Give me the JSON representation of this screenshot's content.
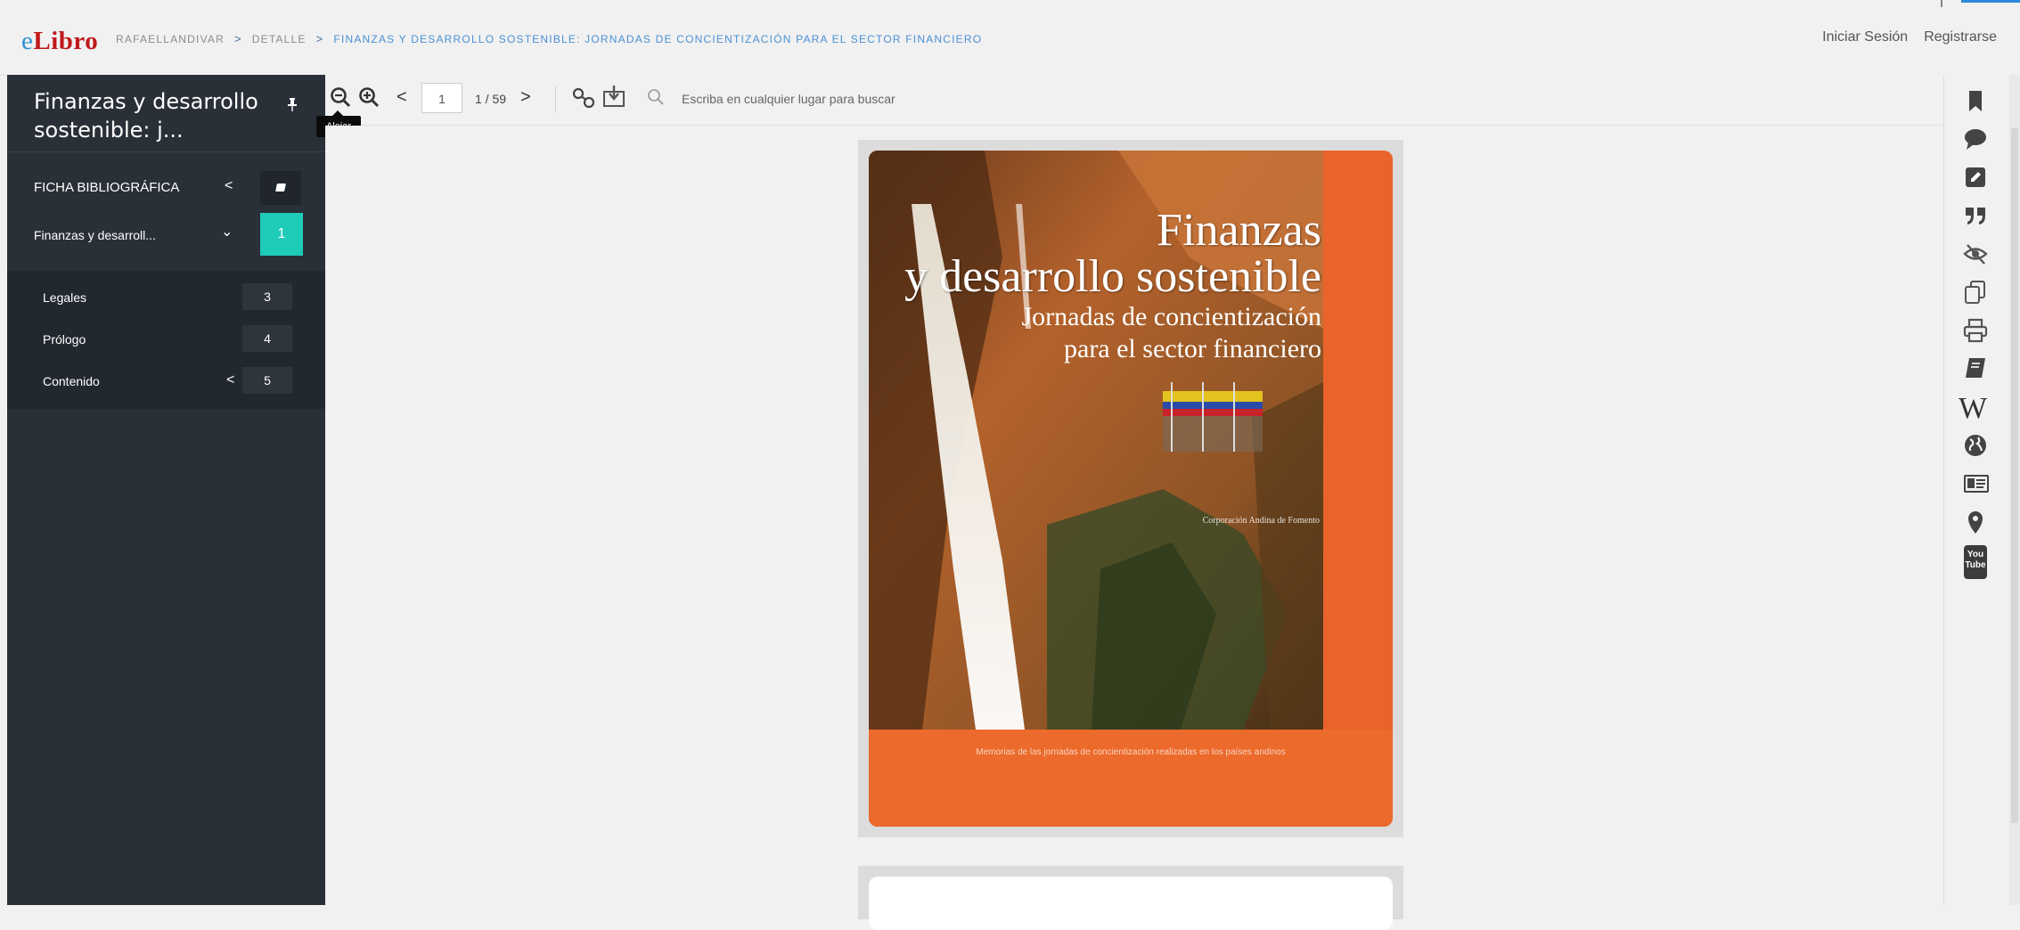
{
  "header": {
    "logo_prefix": "e",
    "logo_main": "Libro",
    "breadcrumb": [
      "RAFAELLANDIVAR",
      "DETALLE",
      "FINANZAS Y DESARROLLO SOSTENIBLE: JORNADAS DE CONCIENTIZACIÓN PARA EL SECTOR FINANCIERO"
    ],
    "breadcrumb_sep": ">",
    "login": "Iniciar Sesión",
    "register": "Registrarse"
  },
  "sidebar": {
    "title": "Finanzas y desarrollo sostenible: j...",
    "pin_icon": "pin-icon",
    "sections": [
      {
        "label": "FICHA BIBLIOGRÁFICA",
        "chevron": "<",
        "badge_icon": "book-icon"
      },
      {
        "label": "Finanzas y desarroll...",
        "chevron": "⌄",
        "page": "1"
      }
    ],
    "subitems": [
      {
        "label": "Legales",
        "page": "3"
      },
      {
        "label": "Prólogo",
        "page": "4"
      },
      {
        "label": "Contenido",
        "page": "5",
        "chevron": "<"
      }
    ],
    "active_color": "#1ecbb8"
  },
  "toolbar": {
    "zoom_out_icon": "zoom-out-icon",
    "zoom_in_icon": "zoom-in-icon",
    "prev": "<",
    "page_value": "1",
    "page_count": "1 / 59",
    "next": ">",
    "link_icon": "link-icon",
    "download_icon": "download-icon",
    "search_icon": "search-icon",
    "search_placeholder": "Escriba en cualquier lugar para buscar",
    "tooltip": "Alejar"
  },
  "cover": {
    "title_1": "Finanzas",
    "title_2": "y desarrollo sostenible",
    "subtitle_1": "Jornadas de concientización",
    "subtitle_2": "para el sector financiero",
    "publisher": "Corporación Andina de Fomento",
    "footer": "Memorias de las jornadas de concientización realizadas en los países andinos"
  },
  "rail_icons": [
    "bookmark-icon",
    "comment-icon",
    "edit-icon",
    "quote-icon",
    "hide-icon",
    "copy-icon",
    "print-icon",
    "book-icon",
    "wikipedia-icon",
    "globe-icon",
    "id-card-icon",
    "map-pin-icon",
    "youtube-icon"
  ],
  "rail_wiki_glyph": "W",
  "rail_youtube_glyph_1": "You",
  "rail_youtube_glyph_2": "Tube"
}
